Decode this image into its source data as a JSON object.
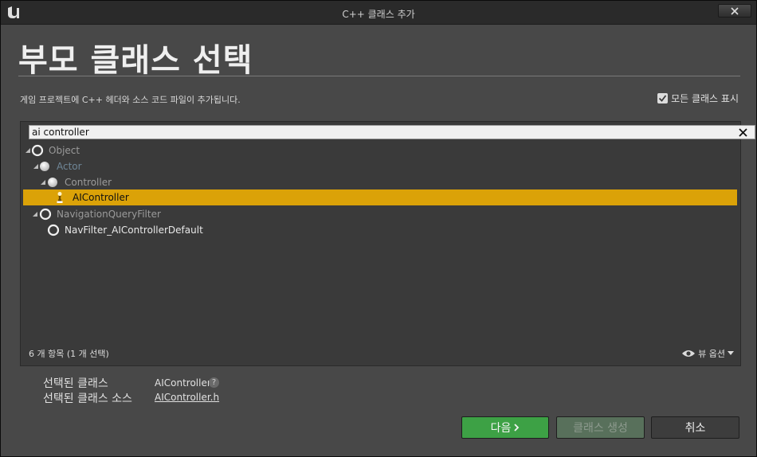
{
  "window": {
    "title": "C++ 클래스 추가",
    "logo_icon": "unreal-logo-icon",
    "close_icon": "close-icon"
  },
  "header": {
    "heading": "부모 클래스 선택",
    "description": "게임 프로젝트에 C++ 헤더와 소스 코드 파일이 추가됩니다.",
    "show_all_label": "모든 클래스 표시",
    "show_all_checked": true
  },
  "search": {
    "value": "ai controller",
    "clear_icon": "close-icon"
  },
  "tree": {
    "items": [
      {
        "label": "Object",
        "depth": 0,
        "expanded": true,
        "icon": "hollow-circle-icon",
        "style": "dim"
      },
      {
        "label": "Actor",
        "depth": 1,
        "expanded": true,
        "icon": "white-sphere-icon",
        "style": "accent"
      },
      {
        "label": "Controller",
        "depth": 2,
        "expanded": true,
        "icon": "white-sphere-icon",
        "style": "dim"
      },
      {
        "label": "AIController",
        "depth": 3,
        "expanded": false,
        "icon": "pawn-icon",
        "style": "selected"
      },
      {
        "label": "NavigationQueryFilter",
        "depth": 0,
        "expanded": true,
        "icon": "hollow-circle-icon",
        "style": "dim"
      },
      {
        "label": "NavFilter_AIControllerDefault",
        "depth": 1,
        "expanded": false,
        "icon": "hollow-circle-icon",
        "style": "white"
      }
    ]
  },
  "footer": {
    "item_count": "6 개 항목 (1 개 선택)",
    "view_options": "뷰 옵션",
    "view_icon": "eye-icon"
  },
  "selection": {
    "class_label": "선택된 클래스",
    "class_value": "AIController",
    "source_label": "선택된 클래스 소스",
    "source_value": "AIController.h"
  },
  "buttons": {
    "next": "다음",
    "create": "클래스 생성",
    "cancel": "취소"
  },
  "colors": {
    "selection_highlight": "#dba208",
    "next_button": "#3da145",
    "create_button_disabled": "#58705b",
    "accent_text": "#6f8697"
  }
}
